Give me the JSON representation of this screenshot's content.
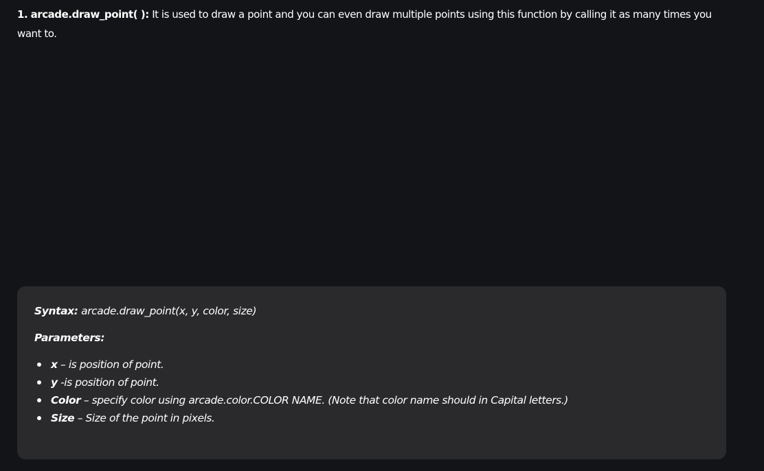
{
  "intro": {
    "number": "1.",
    "function_name": "arcade.draw_point( ):",
    "description": "It is used to draw a point and you can even draw multiple points using this function by calling it as many times you want to."
  },
  "syntax": {
    "label": "Syntax:",
    "code": "arcade.draw_point(x, y, color, size)"
  },
  "parameters": {
    "title": "Parameters:",
    "items": [
      {
        "name": "x",
        "desc": " – is position of point."
      },
      {
        "name": "y",
        "desc": " -is position of point."
      },
      {
        "name": "Color",
        "desc": " – specify color using arcade.color.COLOR NAME. (Note that color name should in Capital letters.)"
      },
      {
        "name": "Size",
        "desc": " – Size of the point in pixels."
      }
    ]
  },
  "colors": {
    "page_background": "#131417",
    "code_box_background": "#2a2a2d",
    "text": "#ffffff"
  }
}
